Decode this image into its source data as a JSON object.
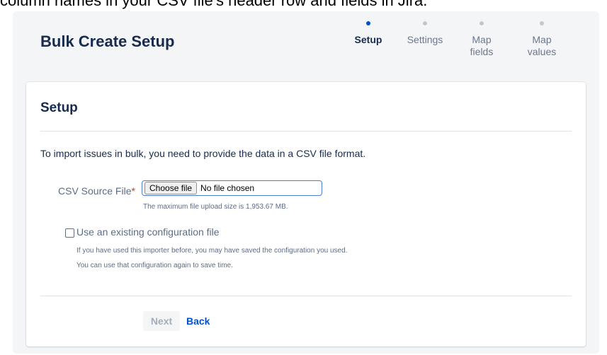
{
  "background_text": "column names in your CSV file's header row and fields in Jira.",
  "header": {
    "title": "Bulk Create Setup"
  },
  "steps": [
    {
      "label": "Setup",
      "active": true
    },
    {
      "label": "Settings",
      "active": false
    },
    {
      "label": "Map\nfields",
      "active": false
    },
    {
      "label": "Map\nvalues",
      "active": false
    }
  ],
  "section": {
    "title": "Setup",
    "intro": "To import issues in bulk, you need to provide the data in a CSV file format."
  },
  "csv_source": {
    "label": "CSV Source File",
    "required_marker": "*",
    "choose_button": "Choose file",
    "status": "No file chosen",
    "help": "The maximum file upload size is 1,953.67 MB."
  },
  "existing_config": {
    "checked": false,
    "label": "Use an existing configuration file",
    "help_line1": "If you have used this importer before, you may have saved the configuration you used.",
    "help_line2": "You can use that configuration again to save time."
  },
  "actions": {
    "next": "Next",
    "back": "Back"
  },
  "colors": {
    "accent": "#0052cc",
    "required": "#de350b",
    "text": "#172b4d",
    "muted": "#5e6c84"
  }
}
